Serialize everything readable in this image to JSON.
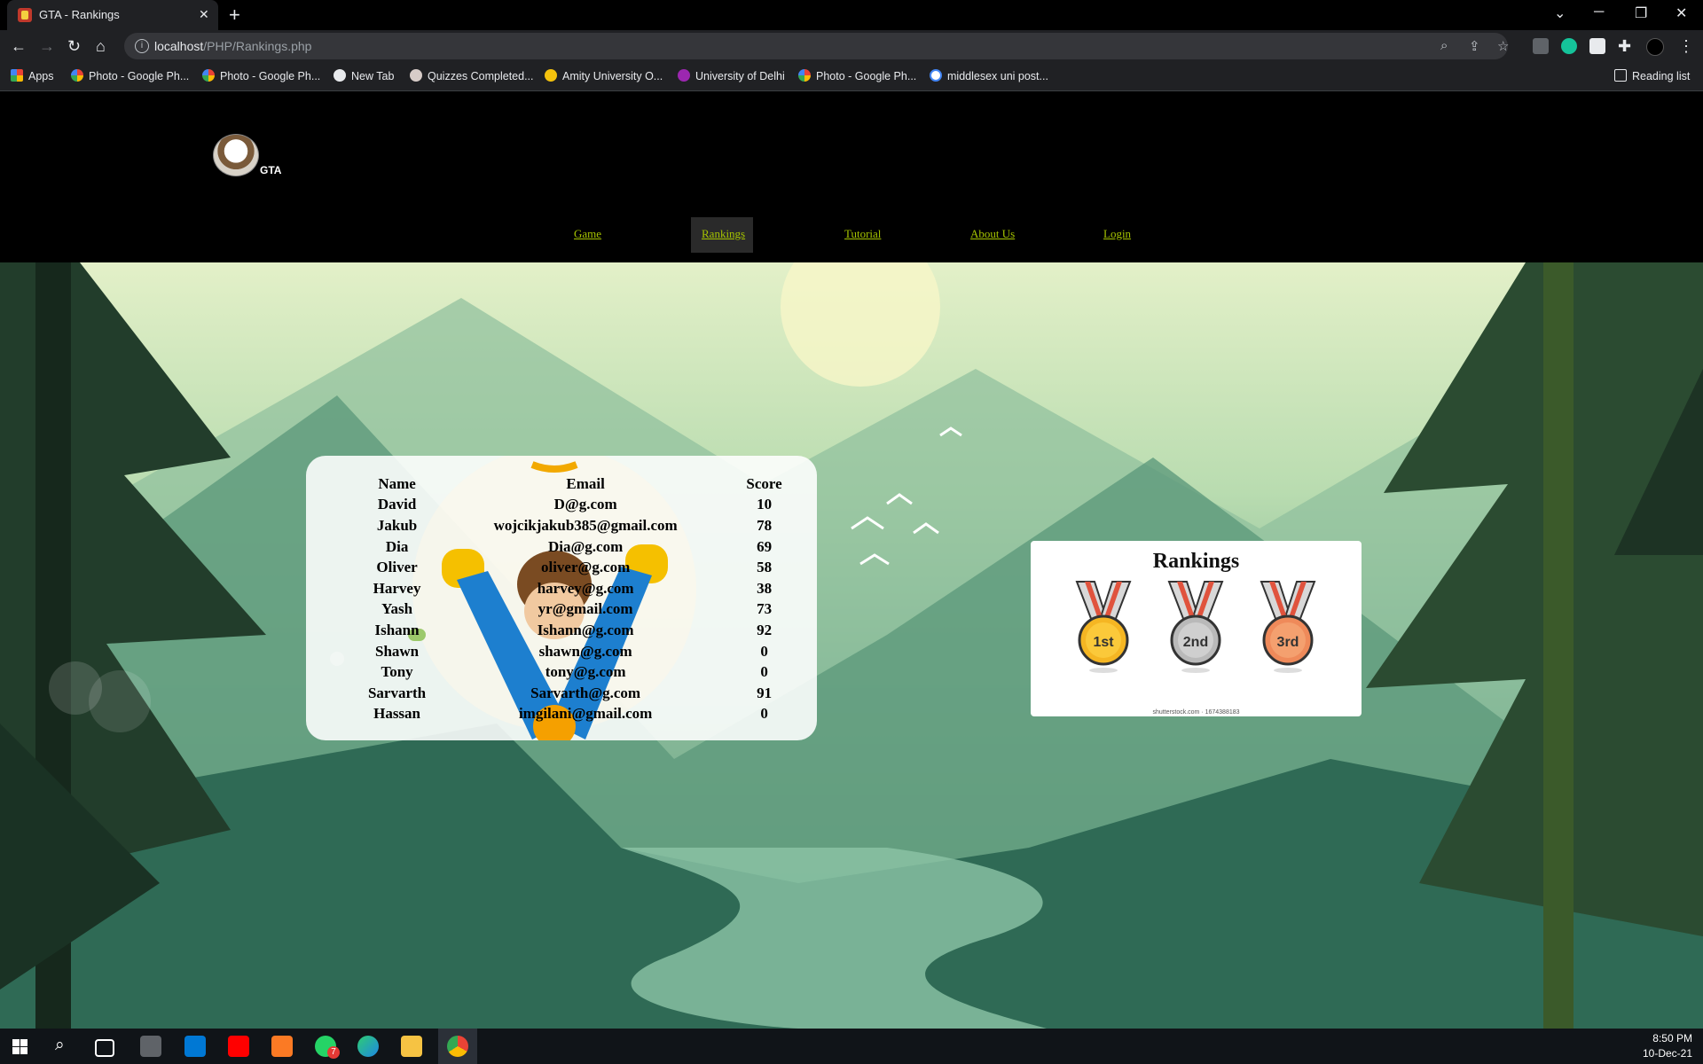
{
  "browser": {
    "tab_title": "GTA - Rankings",
    "url_host": "localhost",
    "url_path": "/PHP/Rankings.php",
    "bookmarks": [
      "Apps",
      "Photo - Google Ph...",
      "Photo - Google Ph...",
      "New Tab",
      "Quizzes Completed...",
      "Amity University O...",
      "University of Delhi",
      "Photo - Google Ph...",
      "middlesex uni post..."
    ],
    "reading_list": "Reading list"
  },
  "site": {
    "logo_text": "GTA",
    "nav": [
      "Game",
      "Rankings",
      "Tutorial",
      "About Us",
      "Login"
    ],
    "active_nav": "Rankings",
    "accent_color": "#a6c400"
  },
  "rankings": {
    "headers": [
      "Name",
      "Email",
      "Score"
    ],
    "rows": [
      [
        "David",
        "D@g.com",
        "10"
      ],
      [
        "Jakub",
        "wojcikjakub385@gmail.com",
        "78"
      ],
      [
        "Dia",
        "Dia@g.com",
        "69"
      ],
      [
        "Oliver",
        "oliver@g.com",
        "58"
      ],
      [
        "Harvey",
        "harvey@g.com",
        "38"
      ],
      [
        "Yash",
        "yr@gmail.com",
        "73"
      ],
      [
        "Ishann",
        "Ishann@g.com",
        "92"
      ],
      [
        "Shawn",
        "shawn@g.com",
        "0"
      ],
      [
        "Tony",
        "tony@g.com",
        "0"
      ],
      [
        "Sarvarth",
        "Sarvarth@g.com",
        "91"
      ],
      [
        "Hassan",
        "imgilani@gmail.com",
        "0"
      ]
    ]
  },
  "medal_card": {
    "title": "Rankings",
    "medals": [
      "1st",
      "2nd",
      "3rd"
    ],
    "credit": "shutterstock.com · 1674388183"
  },
  "taskbar": {
    "time": "8:50 PM",
    "date": "10-Dec-21",
    "whatsapp_badge": "7"
  }
}
